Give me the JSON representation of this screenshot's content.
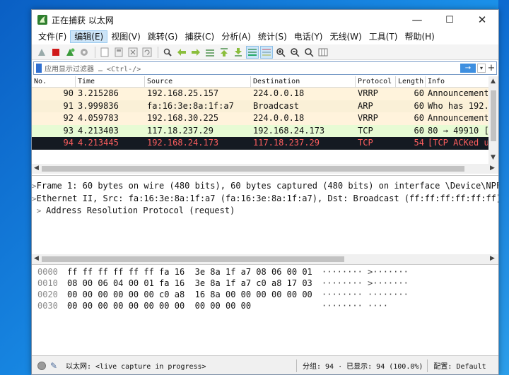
{
  "window": {
    "title": "正在捕获 以太网",
    "min": "—",
    "max": "☐",
    "close": "✕"
  },
  "menu": [
    "文件(F)",
    "编辑(E)",
    "视图(V)",
    "跳转(G)",
    "捕获(C)",
    "分析(A)",
    "统计(S)",
    "电话(Y)",
    "无线(W)",
    "工具(T)",
    "帮助(H)"
  ],
  "toolbar_icons": [
    "shark-fin-icon",
    "stop-icon",
    "restart-icon",
    "options-gear-icon",
    "open-file-icon",
    "save-file-icon",
    "close-file-icon",
    "reload-icon",
    "find-icon",
    "go-back-icon",
    "go-forward-icon",
    "go-to-packet-icon",
    "go-first-icon",
    "go-last-icon",
    "autoscroll-icon",
    "colorize-icon",
    "zoom-in-icon",
    "zoom-out-icon",
    "zoom-normal-icon",
    "resize-columns-icon"
  ],
  "filter": {
    "placeholder": "应用显示过滤器 … <Ctrl-/>",
    "apply": "→",
    "dropdown": "▾",
    "add": "+"
  },
  "packet_list": {
    "columns": [
      "No.",
      "Time",
      "Source",
      "Destination",
      "Protocol",
      "Length",
      "Info"
    ],
    "rows": [
      {
        "no": "90",
        "time": "3.215286",
        "src": "192.168.25.157",
        "dst": "224.0.0.18",
        "proto": "VRRP",
        "len": "60",
        "info": "Announcement",
        "bg": "#fff3dc",
        "fg": "#111111"
      },
      {
        "no": "91",
        "time": "3.999836",
        "src": "fa:16:3e:8a:1f:a7",
        "dst": "Broadcast",
        "proto": "ARP",
        "len": "60",
        "info": "Who has 192.",
        "bg": "#faf0d7",
        "fg": "#111111"
      },
      {
        "no": "92",
        "time": "4.059783",
        "src": "192.168.30.225",
        "dst": "224.0.0.18",
        "proto": "VRRP",
        "len": "60",
        "info": "Announcement",
        "bg": "#fff3dc",
        "fg": "#111111"
      },
      {
        "no": "93",
        "time": "4.213403",
        "src": "117.18.237.29",
        "dst": "192.168.24.173",
        "proto": "TCP",
        "len": "60",
        "info": "80 → 49910 [",
        "bg": "#e7fbd4",
        "fg": "#111111"
      },
      {
        "no": "94",
        "time": "4.213445",
        "src": "192.168.24.173",
        "dst": "117.18.237.29",
        "proto": "TCP",
        "len": "54",
        "info": "[TCP ACKed u",
        "bg": "#141a22",
        "fg": "#ff5f5f"
      }
    ]
  },
  "details": [
    "Frame 1: 60 bytes on wire (480 bits), 60 bytes captured (480 bits) on interface \\Device\\NPF",
    "Ethernet II, Src: fa:16:3e:8a:1f:a7 (fa:16:3e:8a:1f:a7), Dst: Broadcast (ff:ff:ff:ff:ff:ff)",
    "Address Resolution Protocol (request)"
  ],
  "bytes": [
    {
      "offset": "0000",
      "hex": "ff ff ff ff ff ff fa 16  3e 8a 1f a7 08 06 00 01",
      "ascii": "········ >·······"
    },
    {
      "offset": "0010",
      "hex": "08 00 06 04 00 01 fa 16  3e 8a 1f a7 c0 a8 17 03",
      "ascii": "········ >·······"
    },
    {
      "offset": "0020",
      "hex": "00 00 00 00 00 00 c0 a8  16 8a 00 00 00 00 00 00",
      "ascii": "········ ········"
    },
    {
      "offset": "0030",
      "hex": "00 00 00 00 00 00 00 00  00 00 00 00",
      "ascii": "········ ····"
    }
  ],
  "status": {
    "capture": "以太网: <live capture in progress>",
    "packets": "分组: 94 · 已显示: 94 (100.0%)",
    "profile": "配置: Default"
  }
}
